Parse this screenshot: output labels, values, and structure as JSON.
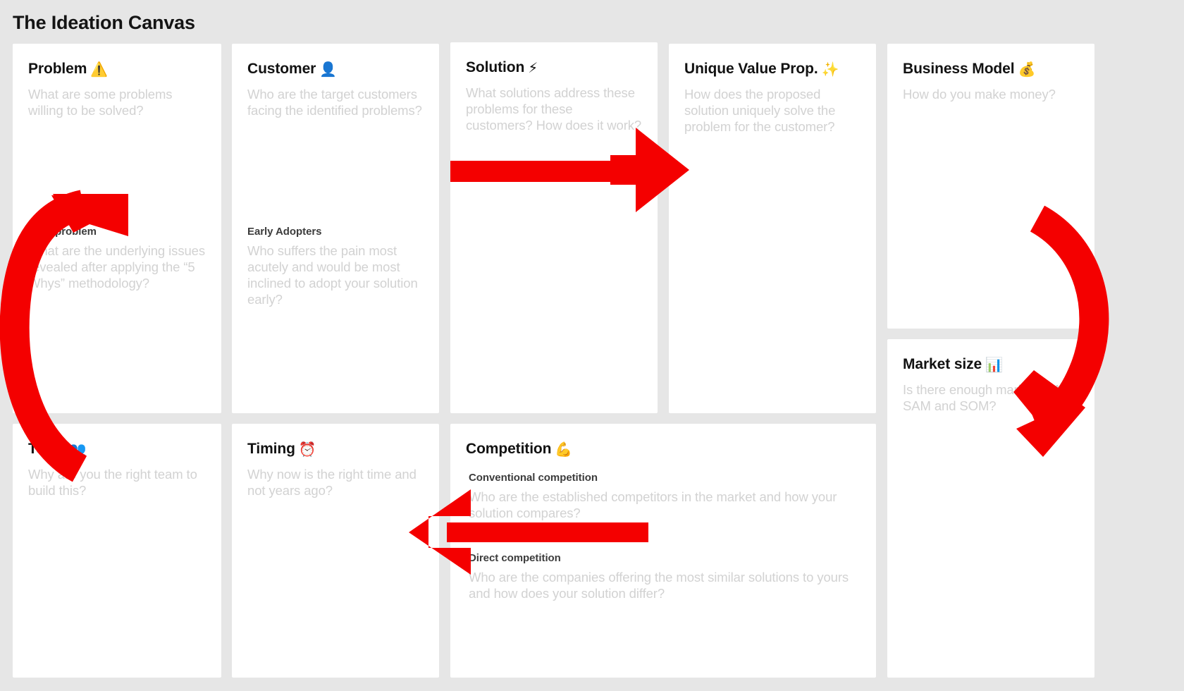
{
  "page": {
    "title": "The Ideation Canvas",
    "background_color": "#e6e6e6",
    "card_color": "#ffffff",
    "arrow_color": "#f40000",
    "placeholder_text_color": "#d2d2d2"
  },
  "cards": [
    {
      "id": "problem",
      "title": "Problem",
      "emoji": "⚠️",
      "emoji_name": "warning-icon",
      "description": "What are some problems willing to be solved?",
      "sub": {
        "title": "Core problem",
        "description": "What are the underlying issues revealed after applying the “5 Whys” methodology?"
      }
    },
    {
      "id": "customer",
      "title": "Customer",
      "emoji": "👤",
      "emoji_name": "bust-in-silhouette-icon",
      "description": "Who are the target customers facing the identified problems?",
      "sub": {
        "title": "Early Adopters",
        "description": "Who suffers the pain most acutely and would be most inclined to adopt your solution early?"
      }
    },
    {
      "id": "solution",
      "title": "Solution",
      "emoji": "⚡",
      "emoji_name": "high-voltage-icon",
      "description": "What solutions address these problems for these customers? How does it work?"
    },
    {
      "id": "uvp",
      "title": "Unique Value Prop.",
      "emoji": "✨",
      "emoji_name": "sparkles-icon",
      "description": "How does the proposed solution uniquely solve the problem for the customer?"
    },
    {
      "id": "business-model",
      "title": "Business Model",
      "emoji": "💰",
      "emoji_name": "money-bag-icon",
      "description": "How do you make money?"
    },
    {
      "id": "market-size",
      "title": "Market size",
      "emoji": "📊",
      "emoji_name": "bar-chart-icon",
      "description": "Is there enough market? TAM, SAM and SOM?"
    },
    {
      "id": "team",
      "title": "Team",
      "emoji": "👥",
      "emoji_name": "busts-in-silhouette-icon",
      "description": "Why are you the right team to build this?"
    },
    {
      "id": "timing",
      "title": "Timing",
      "emoji": "⏰",
      "emoji_name": "alarm-clock-icon",
      "description": "Why now is the right time and not years ago?"
    },
    {
      "id": "competition",
      "title": "Competition",
      "emoji": "💪",
      "emoji_name": "flexed-biceps-icon",
      "sub_conventional": {
        "title": "Conventional competition",
        "description": "Who are the established competitors in the market and how your solution compares?"
      },
      "sub_direct": {
        "title": "Direct competition",
        "description": "Who are the companies offering the most similar solutions to yours and how does your solution differ?"
      }
    }
  ],
  "arrows": [
    {
      "name": "arrow-team-to-problem",
      "shape": "curved-up-left"
    },
    {
      "name": "arrow-solution-to-uvp",
      "shape": "straight-right"
    },
    {
      "name": "arrow-business-model-to-market-size",
      "shape": "curved-down-right"
    },
    {
      "name": "arrow-competition-to-timing",
      "shape": "straight-left"
    }
  ]
}
